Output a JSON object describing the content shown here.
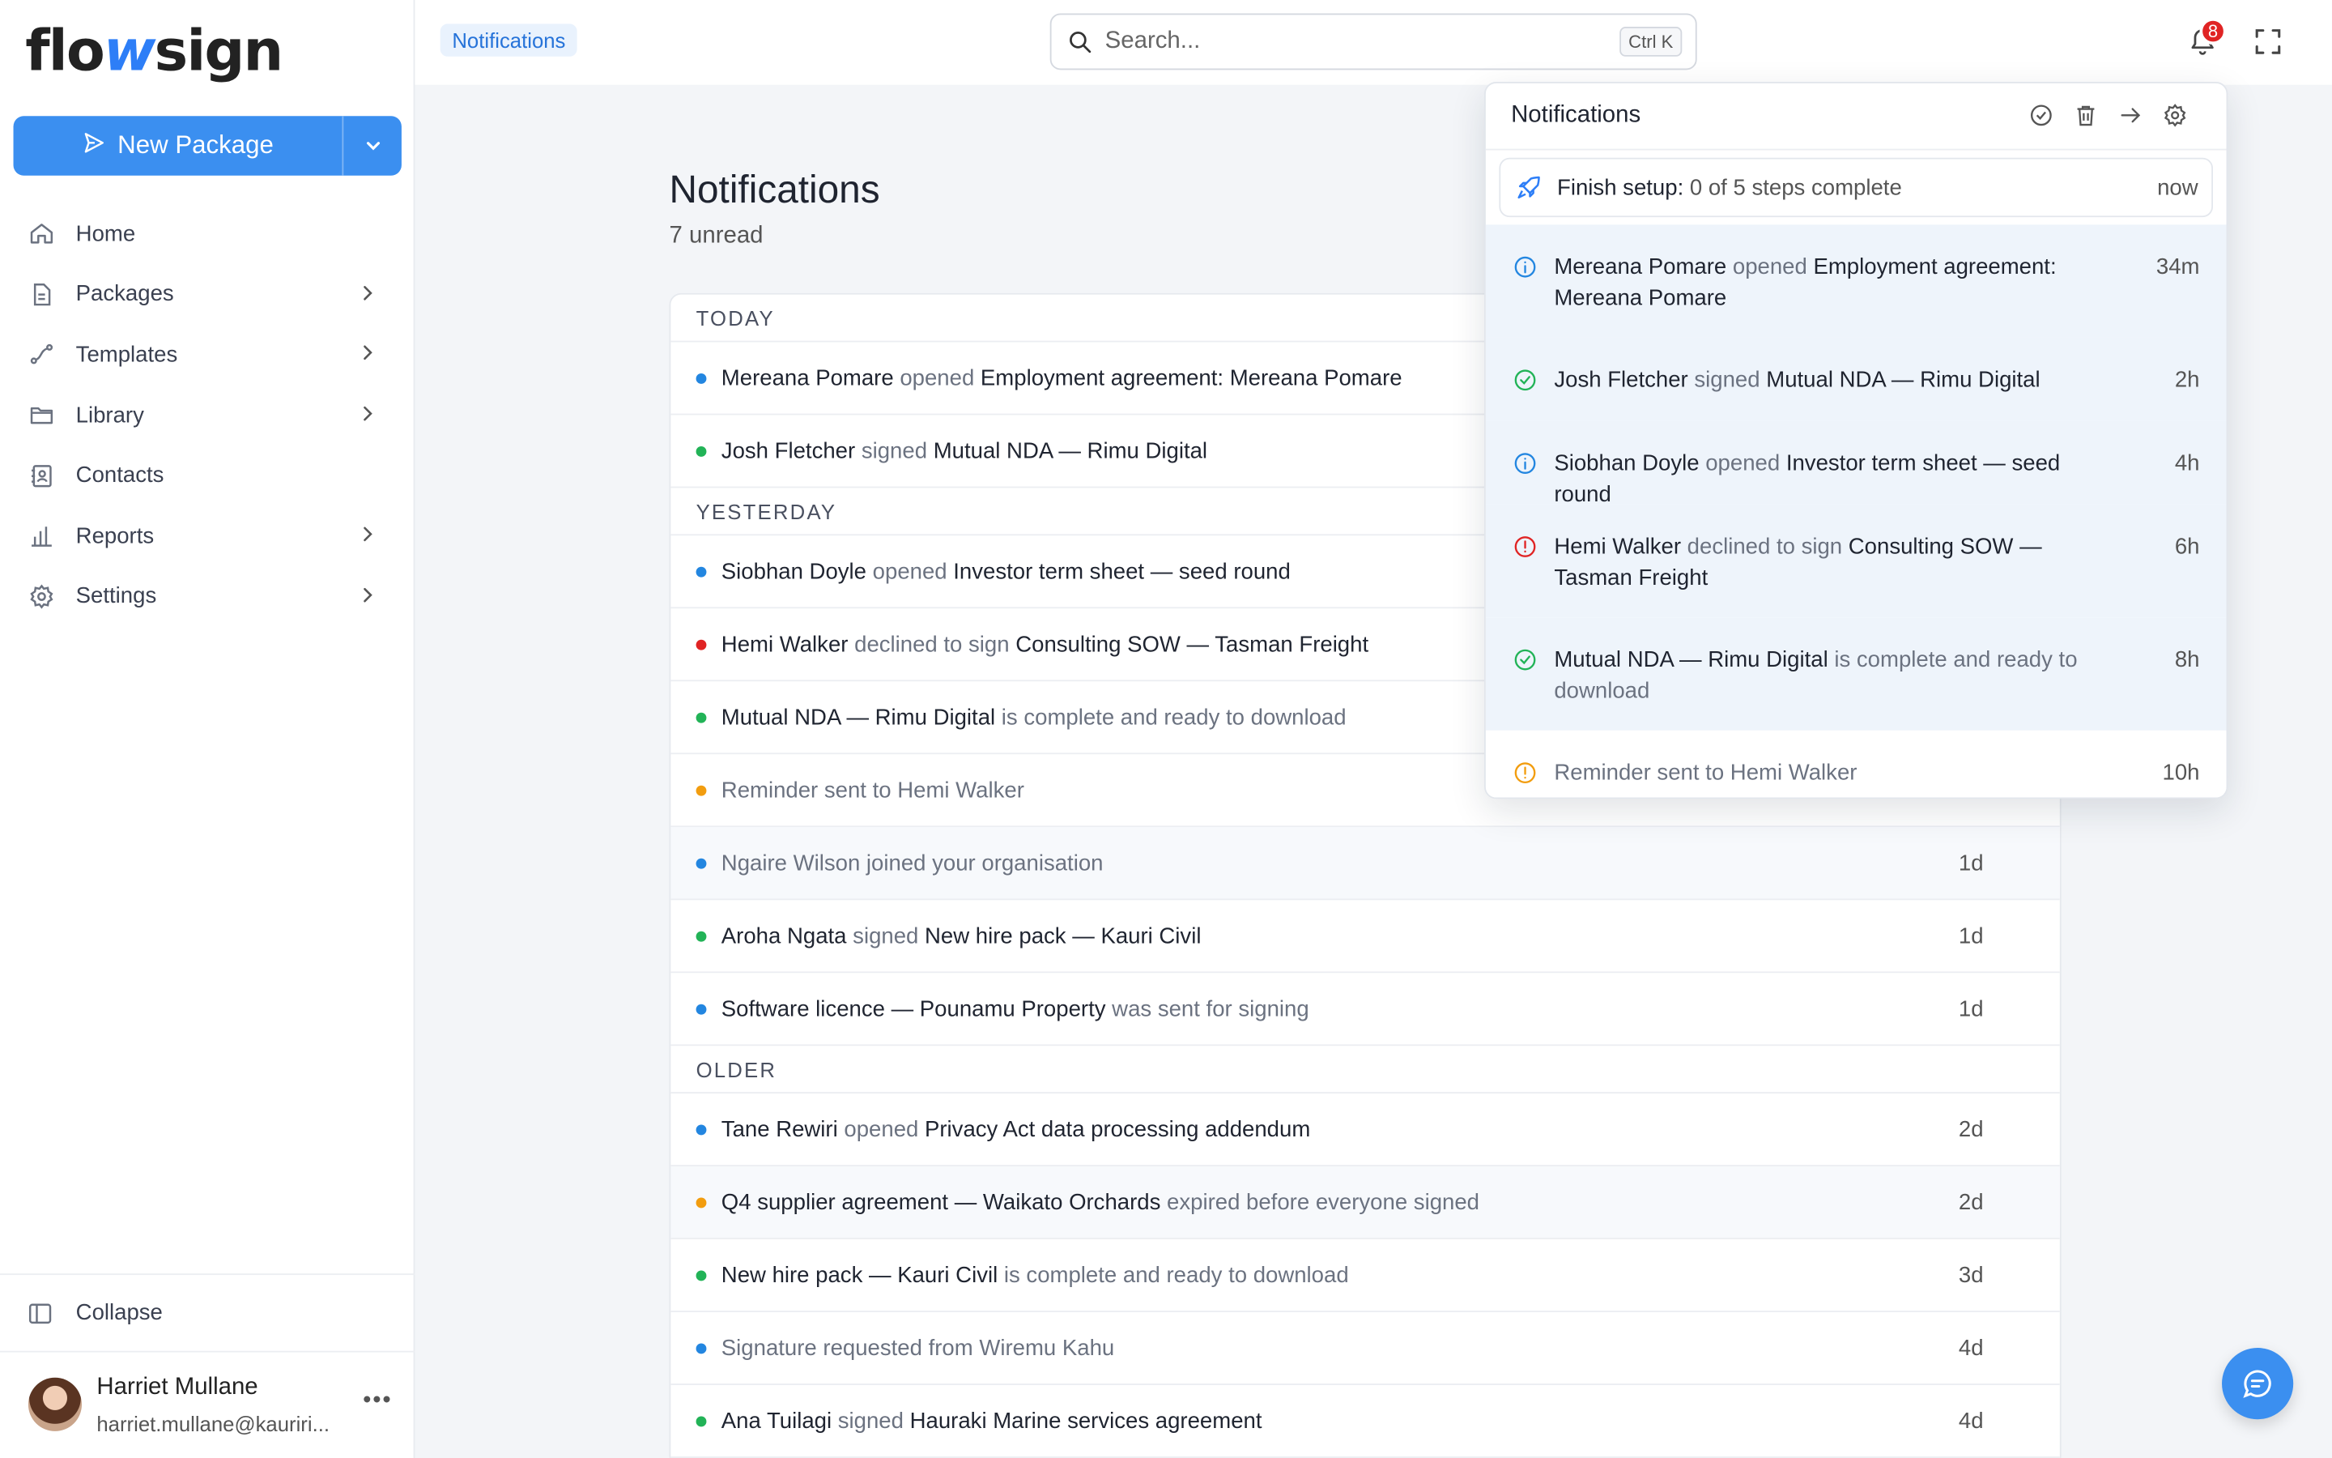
{
  "app": {
    "logo_a": "flo",
    "logo_b": "w",
    "logo_c": "sign"
  },
  "sidebar": {
    "new_package_label": "New Package",
    "items": [
      {
        "label": "Home",
        "icon": "home-icon",
        "has_chevron": false
      },
      {
        "label": "Packages",
        "icon": "document-icon",
        "has_chevron": true
      },
      {
        "label": "Templates",
        "icon": "route-icon",
        "has_chevron": true
      },
      {
        "label": "Library",
        "icon": "folder-icon",
        "has_chevron": true
      },
      {
        "label": "Contacts",
        "icon": "contact-book-icon",
        "has_chevron": false
      },
      {
        "label": "Reports",
        "icon": "bar-chart-icon",
        "has_chevron": true
      },
      {
        "label": "Settings",
        "icon": "gear-icon",
        "has_chevron": true
      }
    ],
    "collapse_label": "Collapse",
    "user": {
      "name": "Harriet Mullane",
      "email": "harriet.mullane@kauriri...",
      "menu": "•••"
    }
  },
  "topbar": {
    "breadcrumb": "Notifications",
    "search_placeholder": "Search...",
    "search_shortcut": "Ctrl K",
    "notification_count": "8"
  },
  "main": {
    "title": "Notifications",
    "subtitle": "7 unread",
    "groups": [
      {
        "label": "TODAY",
        "rows": [
          {
            "a": "Mereana Pomare",
            "b": " opened ",
            "c": "Employment agreement: Mereana Pomare",
            "time": "",
            "color": "#2386e0",
            "read": false,
            "alt": false
          },
          {
            "a": "Josh Fletcher",
            "b": " signed ",
            "c": "Mutual NDA — Rimu Digital",
            "time": "",
            "color": "#22b357",
            "read": false,
            "alt": false
          }
        ]
      },
      {
        "label": "YESTERDAY",
        "rows": [
          {
            "a": "Siobhan Doyle",
            "b": " opened ",
            "c": "Investor term sheet — seed round",
            "time": "",
            "color": "#2386e0",
            "read": false,
            "alt": false
          },
          {
            "a": "Hemi Walker",
            "b": " declined to sign ",
            "c": "Consulting SOW — Tasman Freight",
            "time": "",
            "color": "#e02424",
            "read": false,
            "alt": false
          },
          {
            "a": "Mutual NDA — Rimu Digital",
            "b": " is complete and ready to download",
            "c": "",
            "time": "",
            "color": "#22b357",
            "read": false,
            "alt": false
          },
          {
            "a": "Reminder sent to Hemi Walker",
            "b": "",
            "c": "",
            "time": "",
            "color": "#f29d0f",
            "read": true,
            "alt": false
          },
          {
            "a": "Ngaire Wilson joined your organisation",
            "b": "",
            "c": "",
            "time": "1d",
            "color": "#2386e0",
            "read": true,
            "alt": true
          },
          {
            "a": "Aroha Ngata",
            "b": " signed ",
            "c": "New hire pack — Kauri Civil",
            "time": "1d",
            "color": "#22b357",
            "read": false,
            "alt": false
          },
          {
            "a": "Software licence — Pounamu Property",
            "b": " was sent for signing",
            "c": "",
            "time": "1d",
            "color": "#2386e0",
            "read": false,
            "alt": false
          }
        ]
      },
      {
        "label": "OLDER",
        "rows": [
          {
            "a": "Tane Rewiri",
            "b": " opened ",
            "c": "Privacy Act data processing addendum",
            "time": "2d",
            "color": "#2386e0",
            "read": false,
            "alt": false
          },
          {
            "a": "Q4 supplier agreement — Waikato Orchards",
            "b": " expired before everyone signed",
            "c": "",
            "time": "2d",
            "color": "#f29d0f",
            "read": false,
            "alt": true
          },
          {
            "a": "New hire pack — Kauri Civil",
            "b": " is complete and ready to download",
            "c": "",
            "time": "3d",
            "color": "#22b357",
            "read": false,
            "alt": false
          },
          {
            "a": "Signature requested from Wiremu Kahu",
            "b": "",
            "c": "",
            "time": "4d",
            "color": "#2386e0",
            "read": true,
            "alt": false
          },
          {
            "a": "Ana Tuilagi",
            "b": " signed ",
            "c": "Hauraki Marine services agreement",
            "time": "4d",
            "color": "#22b357",
            "read": false,
            "alt": false
          }
        ]
      }
    ]
  },
  "panel": {
    "title": "Notifications",
    "setup": {
      "label": "Finish setup:",
      "detail": " 0 of 5 steps complete",
      "time": "now"
    },
    "items": [
      {
        "a": "Mereana Pomare",
        "b": " opened ",
        "c": "Employment agreement: Mereana Pomare",
        "time": "34m",
        "kind": "info",
        "read": false,
        "h": 76
      },
      {
        "a": "Josh Fletcher",
        "b": " signed ",
        "c": "Mutual NDA — Rimu Digital",
        "time": "2h",
        "kind": "success",
        "read": false,
        "h": 56
      },
      {
        "a": "Siobhan Doyle",
        "b": " opened ",
        "c": "Investor term sheet — seed round",
        "time": "4h",
        "kind": "info",
        "read": false,
        "h": 56
      },
      {
        "a": "Hemi Walker",
        "b": " declined to sign ",
        "c": "Consulting SOW — Tasman Freight",
        "time": "6h",
        "kind": "error",
        "read": false,
        "h": 76
      },
      {
        "a": "Mutual NDA — Rimu Digital",
        "b": " is complete and ready to download",
        "c": "",
        "time": "8h",
        "kind": "success",
        "read": false,
        "h": 76
      },
      {
        "a": "Reminder sent to Hemi Walker",
        "b": "",
        "c": "",
        "time": "10h",
        "kind": "warning",
        "read": true,
        "h": 56
      }
    ]
  },
  "colors": {
    "accent": "#3b8ff0",
    "info": "#2386e0",
    "success": "#22b357",
    "error": "#e02424",
    "warning": "#f29d0f"
  }
}
